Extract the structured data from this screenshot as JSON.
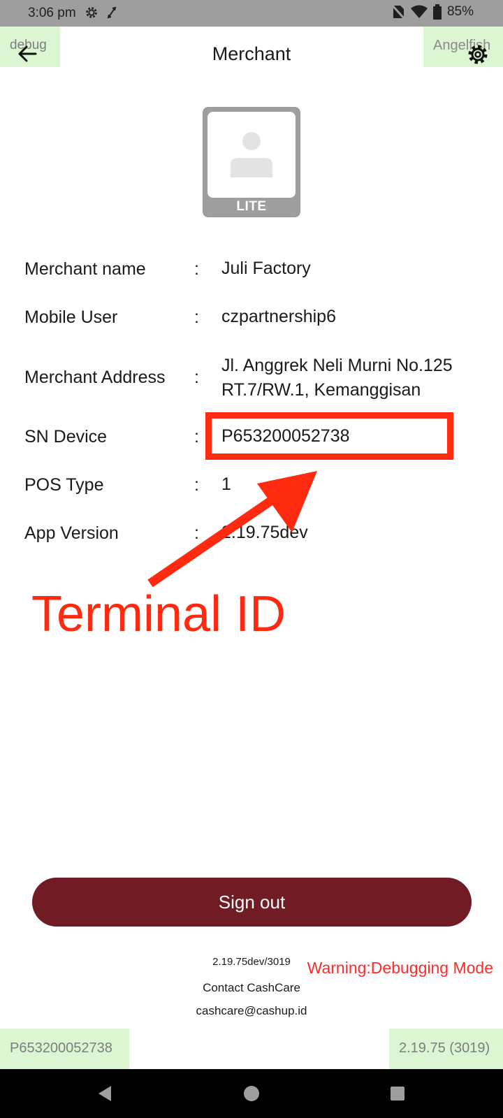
{
  "status_bar": {
    "time": "3:06 pm",
    "battery": "85%",
    "icons": [
      "gear-icon",
      "sync-icon",
      "no-sim-icon",
      "wifi-icon",
      "battery-icon"
    ]
  },
  "app_bar": {
    "debug_tag": "debug",
    "title": "Merchant",
    "brand_tag": "Angelfish",
    "icons": [
      "back-arrow-icon",
      "settings-gear-icon"
    ]
  },
  "avatar": {
    "badge": "LITE",
    "icon": "user-placeholder-icon"
  },
  "merchant_info": [
    {
      "label": "Merchant name",
      "separator": ":",
      "value": "Juli Factory"
    },
    {
      "label": "Mobile User",
      "separator": ":",
      "value": "czpartnership6"
    },
    {
      "label": "Merchant Address",
      "separator": ":",
      "value": "Jl. Anggrek Neli Murni No.125",
      "value_line2": "RT.7/RW.1, Kemanggisan"
    },
    {
      "label": "SN Device",
      "separator": ":",
      "value": "P653200052738"
    },
    {
      "label": "POS Type",
      "separator": ":",
      "value": "1"
    },
    {
      "label": "App Version",
      "separator": ":",
      "value": "2.19.75dev"
    }
  ],
  "annotation": {
    "label": "Terminal ID",
    "color": "#ff2a0f"
  },
  "actions": {
    "signout_label": "Sign out",
    "signout_color": "#711b25"
  },
  "footer": {
    "version_build": "2.19.75dev/3019",
    "warning": "Warning:Debugging Mode",
    "contact_label": "Contact CashCare",
    "contact_email": "cashcare@cashup.id",
    "sn_tag": "P653200052738",
    "version_tag": "2.19.75 (3019)"
  },
  "nav_bar": {
    "icons": [
      "back-triangle-icon",
      "home-circle-icon",
      "recents-square-icon"
    ]
  },
  "colors": {
    "status_bar": "#9e9e9e",
    "debug_tag_bg": "#dcf5d3",
    "warning": "#ff2a2a"
  }
}
